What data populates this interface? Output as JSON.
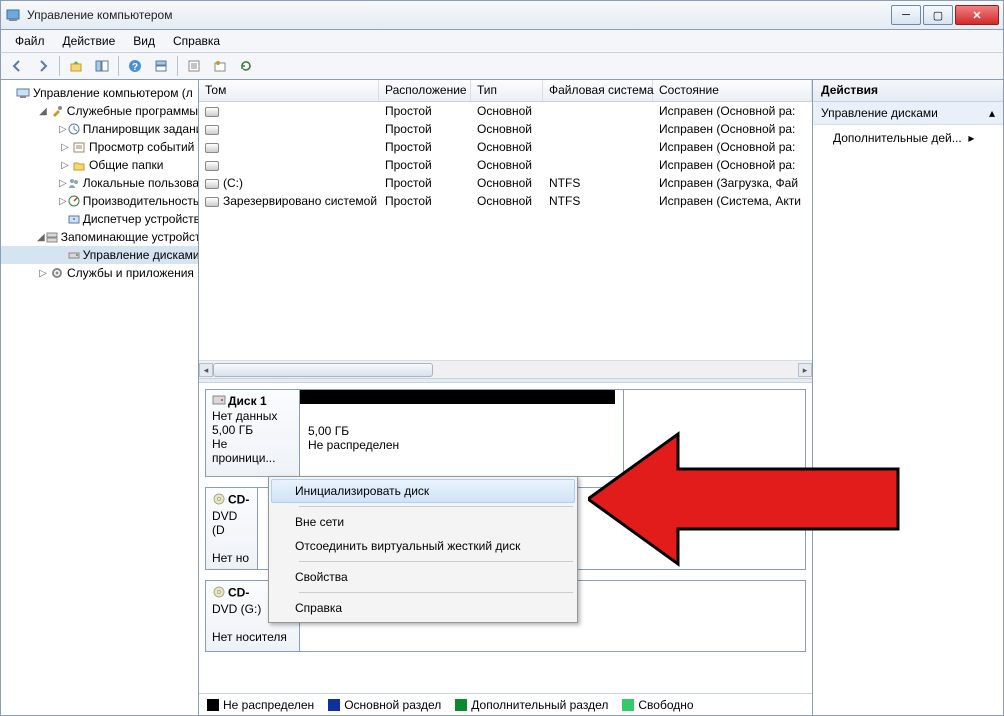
{
  "window": {
    "title": "Управление компьютером",
    "buttons": {
      "min": "—",
      "max": "☐",
      "close": "X"
    }
  },
  "menu": {
    "file": "Файл",
    "action": "Действие",
    "view": "Вид",
    "help": "Справка"
  },
  "tree": {
    "root": "Управление компьютером (л",
    "tools": "Служебные программы",
    "scheduler": "Планировщик заданий",
    "events": "Просмотр событий",
    "shared": "Общие папки",
    "users": "Локальные пользовате",
    "perf": "Производительность",
    "devmgr": "Диспетчер устройств",
    "storage": "Запоминающие устройст",
    "diskmgmt": "Управление дисками",
    "services": "Службы и приложения"
  },
  "table": {
    "headers": {
      "tom": "Том",
      "ras": "Расположение",
      "tip": "Тип",
      "fs": "Файловая система",
      "st": "Состояние"
    },
    "rows": [
      {
        "tom": "",
        "ras": "Простой",
        "tip": "Основной",
        "fs": "",
        "st": "Исправен (Основной ра:"
      },
      {
        "tom": "",
        "ras": "Простой",
        "tip": "Основной",
        "fs": "",
        "st": "Исправен (Основной ра:"
      },
      {
        "tom": "",
        "ras": "Простой",
        "tip": "Основной",
        "fs": "",
        "st": "Исправен (Основной ра:"
      },
      {
        "tom": "",
        "ras": "Простой",
        "tip": "Основной",
        "fs": "",
        "st": "Исправен (Основной ра:"
      },
      {
        "tom": "(C:)",
        "ras": "Простой",
        "tip": "Основной",
        "fs": "NTFS",
        "st": "Исправен (Загрузка, Фай"
      },
      {
        "tom": "Зарезервировано системой",
        "ras": "Простой",
        "tip": "Основной",
        "fs": "NTFS",
        "st": "Исправен (Система, Акти"
      }
    ]
  },
  "disks": {
    "d1": {
      "name": "Диск 1",
      "l1": "Нет данных",
      "l2": "5,00 ГБ",
      "l3": "Не проиници...",
      "p_size": "5,00 ГБ",
      "p_state": "Не распределен"
    },
    "cd1": {
      "name": "CD-",
      "drive": "DVD (D",
      "state": "Нет но"
    },
    "cd2": {
      "name": "CD-",
      "drive": "DVD (G:)",
      "state": "Нет носителя"
    }
  },
  "context": {
    "init": "Инициализировать диск",
    "offline": "Вне сети",
    "detach": "Отсоединить виртуальный жесткий диск",
    "props": "Свойства",
    "help": "Справка"
  },
  "legend": {
    "unalloc": "Не распределен",
    "primary": "Основной раздел",
    "extended": "Дополнительный раздел",
    "free": "Свободно"
  },
  "actions": {
    "header": "Действия",
    "section": "Управление дисками",
    "more": "Дополнительные дей..."
  }
}
